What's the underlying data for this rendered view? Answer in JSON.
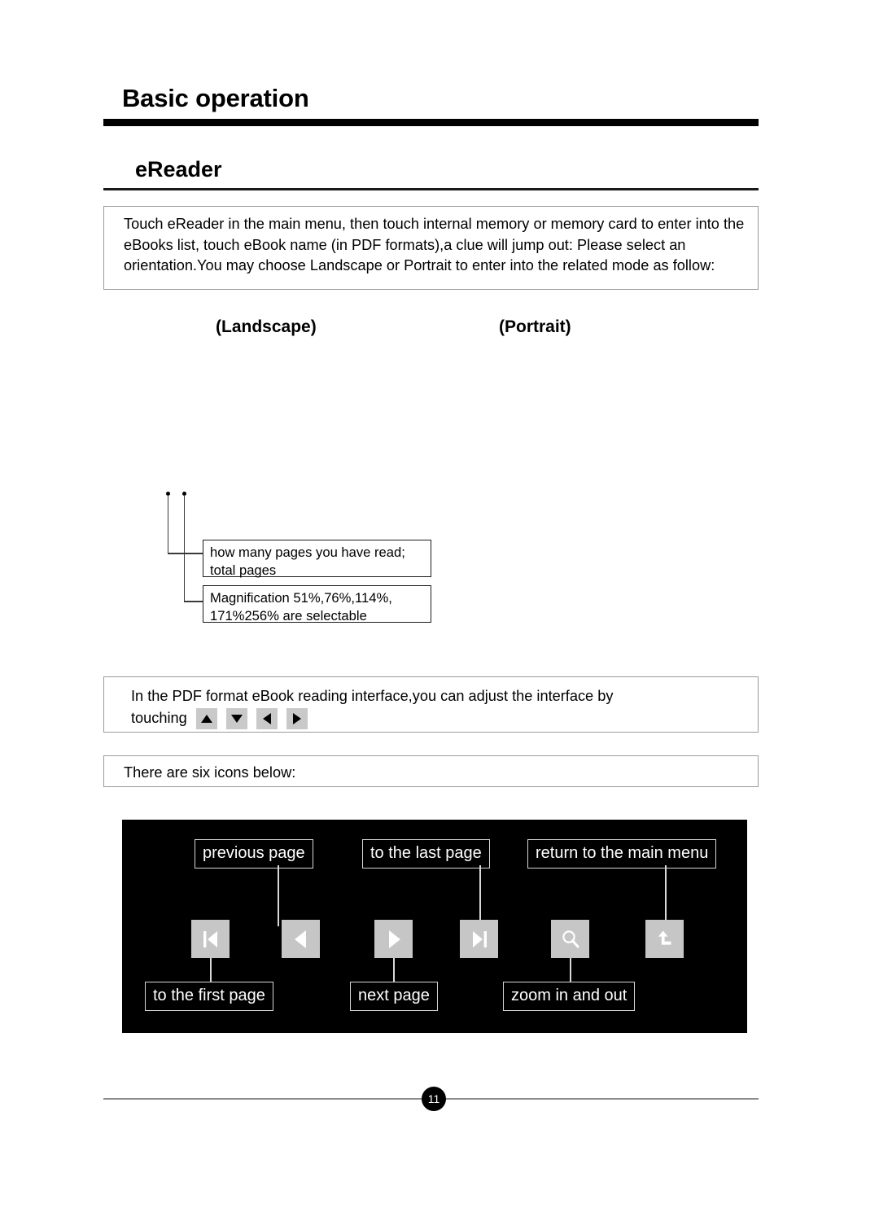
{
  "header": {
    "chapter_title": "Basic operation",
    "section_title": "eReader"
  },
  "intro_note": {
    "text": "Touch eReader in the main menu, then touch internal memory or memory card to enter into the eBooks list, touch eBook name (in PDF formats),a clue will jump out: Please select an orientation.You may choose Landscape or Portrait to enter into the related mode as follow:"
  },
  "orientations": {
    "landscape": "(Landscape)",
    "portrait": "(Portrait)"
  },
  "callouts": [
    {
      "line1": "how many pages you have read;",
      "line2": "total pages"
    },
    {
      "line1": "Magnification 51%,76%,114%,",
      "line2": "171%256%  are selectable"
    }
  ],
  "adjust_note": {
    "line1": "In the PDF format eBook reading interface,you can adjust the interface by",
    "line2_prefix": "touching",
    "buttons": [
      {
        "icon": "triangle-up-icon"
      },
      {
        "icon": "triangle-down-icon"
      },
      {
        "icon": "triangle-left-icon"
      },
      {
        "icon": "triangle-right-icon"
      }
    ]
  },
  "icons_note": {
    "text": "There are six icons below:"
  },
  "icon_panel": {
    "background": "#000000",
    "icon_background": "#c6c6c6",
    "top_labels": [
      {
        "text": "previous page"
      },
      {
        "text": "to the last page"
      },
      {
        "text": "return to the main menu"
      }
    ],
    "bottom_labels": [
      {
        "text": "to the first page"
      },
      {
        "text": "next page"
      },
      {
        "text": "zoom in and out"
      }
    ],
    "icons": [
      {
        "name": "first-page-icon"
      },
      {
        "name": "previous-page-icon"
      },
      {
        "name": "next-page-icon"
      },
      {
        "name": "last-page-icon"
      },
      {
        "name": "zoom-search-icon"
      },
      {
        "name": "return-to-menu-icon"
      }
    ]
  },
  "footer": {
    "page_number": "11"
  }
}
